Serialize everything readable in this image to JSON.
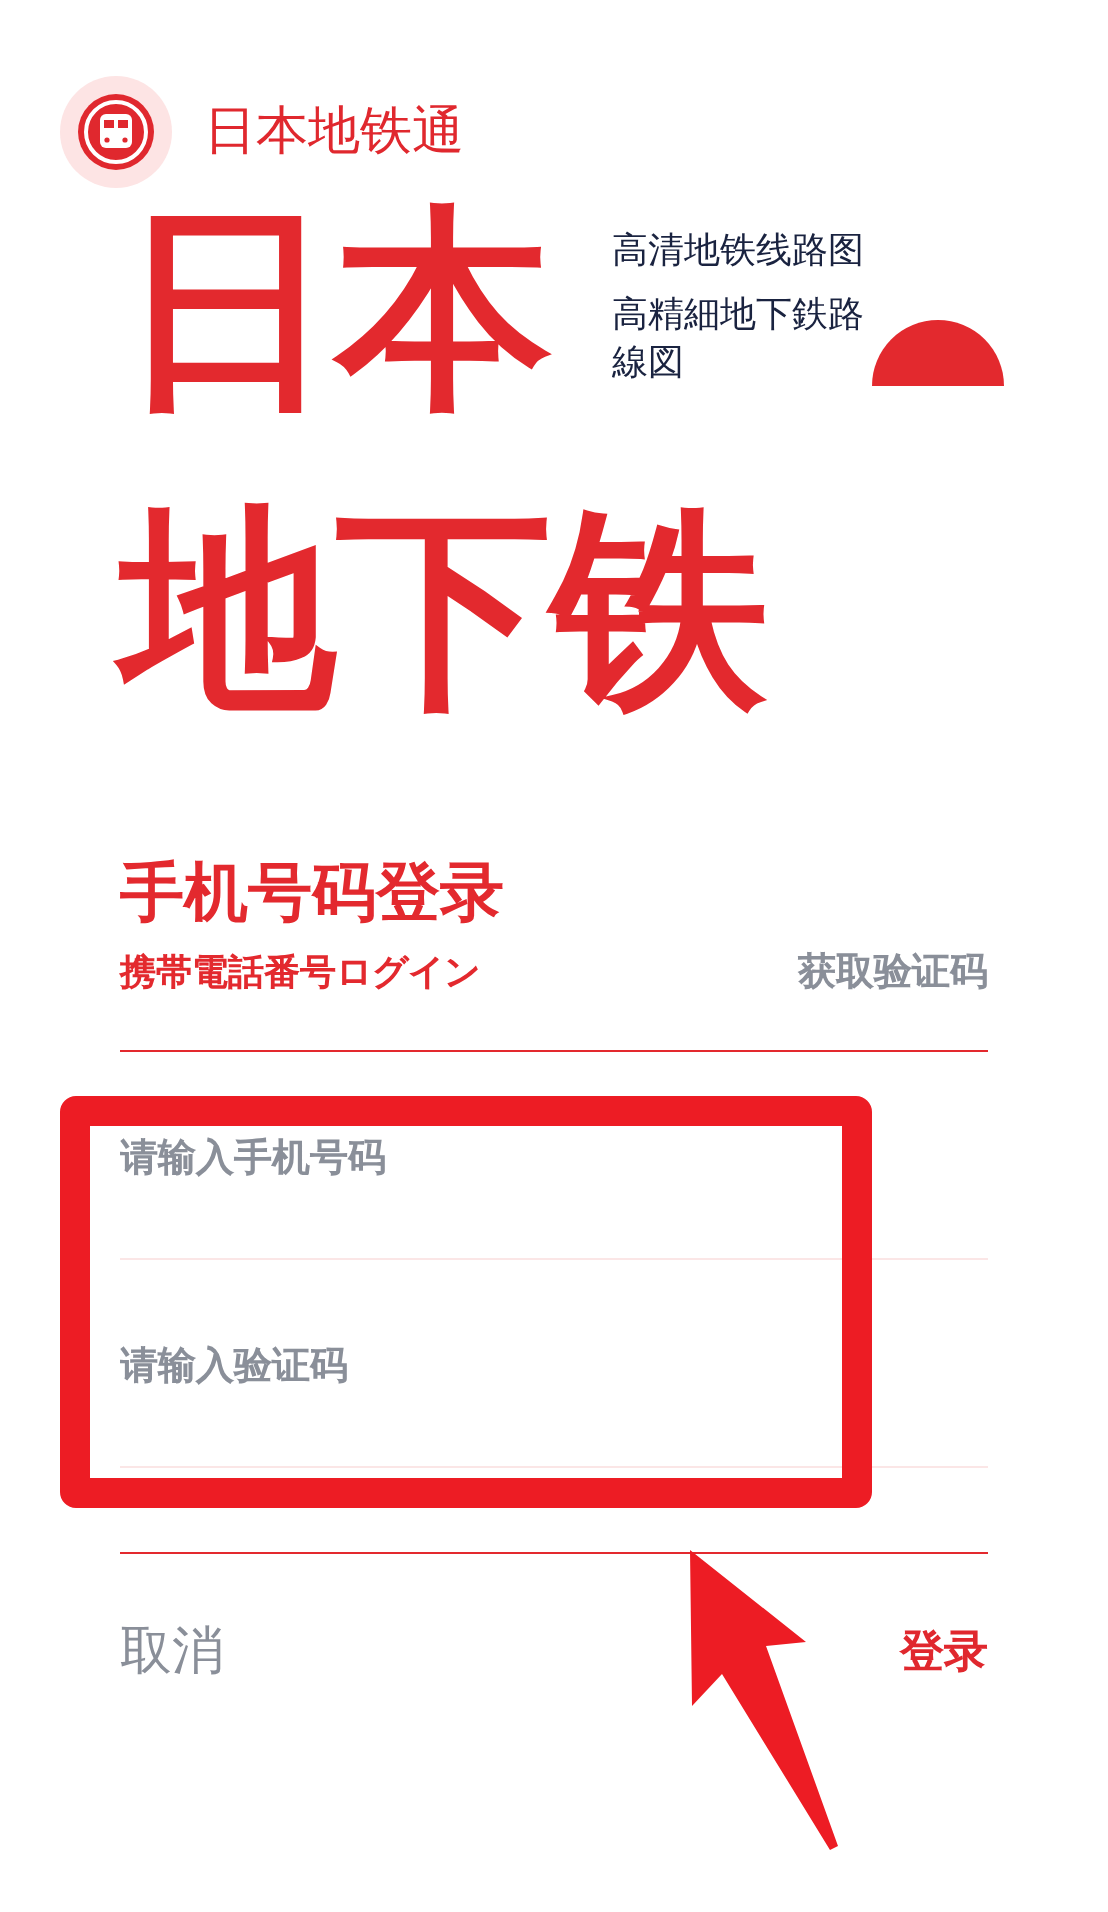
{
  "app": {
    "name": "日本地铁通"
  },
  "hero": {
    "line_1": "日本",
    "line_2": "地下铁",
    "taglines": [
      "高清地铁线路图",
      "高精細地下鉄路線図"
    ]
  },
  "login": {
    "title": "手机号码登录",
    "subtitle": "携帯電話番号ログイン",
    "get_code": "获取验证码",
    "fields": [
      {
        "placeholder": "请输入手机号码"
      },
      {
        "placeholder": "请输入验证码"
      }
    ],
    "buttons": [
      {
        "label": "取消",
        "kind": "cancel"
      },
      {
        "label": "登录",
        "kind": "primary"
      }
    ]
  }
}
